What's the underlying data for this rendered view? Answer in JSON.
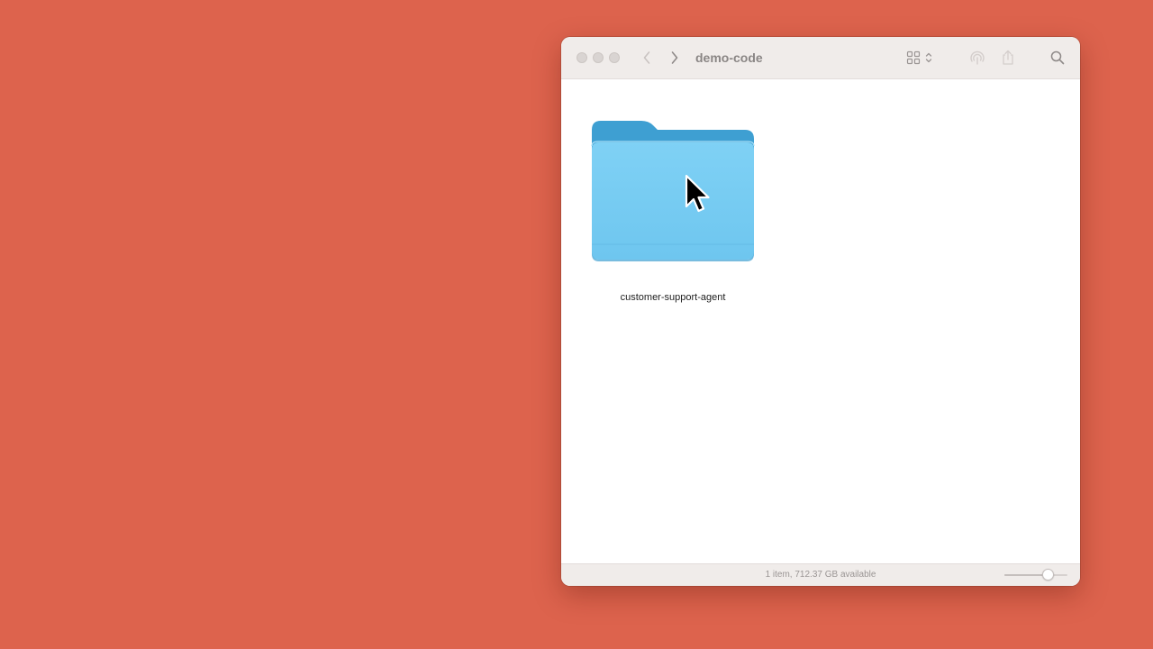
{
  "window": {
    "title": "demo-code"
  },
  "toolbar": {
    "icons": [
      "chevron-left-icon",
      "chevron-right-icon",
      "grid-view-icon",
      "updown-chevron-icon",
      "airdrop-icon",
      "share-icon",
      "search-icon"
    ]
  },
  "files": [
    {
      "name": "customer-support-agent",
      "icon": "folder-icon",
      "color": "#75CBF2"
    }
  ],
  "statusbar": {
    "text": "1 item, 712.37 GB available",
    "icon_size_level": 0.68
  },
  "colors": {
    "desktop": "#DD634D",
    "folder_front": "#75CBF2",
    "folder_back": "#3E9FD2"
  }
}
